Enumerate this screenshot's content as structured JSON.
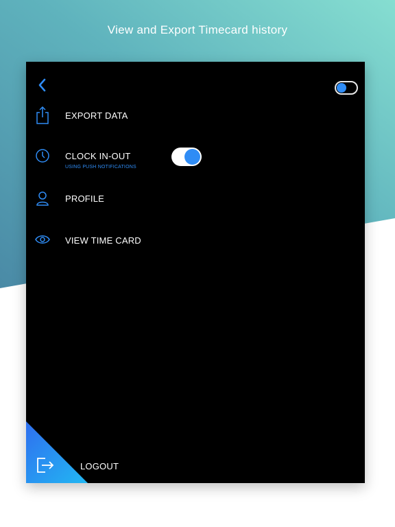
{
  "headline": "View and Export Timecard history",
  "colors": {
    "accent": "#2f8cf5",
    "panel": "#000000",
    "gradient_top": "#7fdccf",
    "gradient_bottom": "#4a8fa8"
  },
  "header": {
    "back_icon": "chevron-left-icon",
    "toggle_on": true
  },
  "menu": {
    "export": {
      "label": "EXPORT DATA",
      "icon": "share-export-icon"
    },
    "clock": {
      "label": "CLOCK IN-OUT",
      "sublabel": "USING PUSH NOTIFICATIONS",
      "icon": "clock-icon",
      "toggle_on": true
    },
    "profile": {
      "label": "PROFILE",
      "icon": "user-icon"
    },
    "timecard": {
      "label": "VIEW TIME CARD",
      "icon": "eye-icon"
    }
  },
  "footer": {
    "logout_label": "LOGOUT",
    "logout_icon": "logout-icon"
  }
}
